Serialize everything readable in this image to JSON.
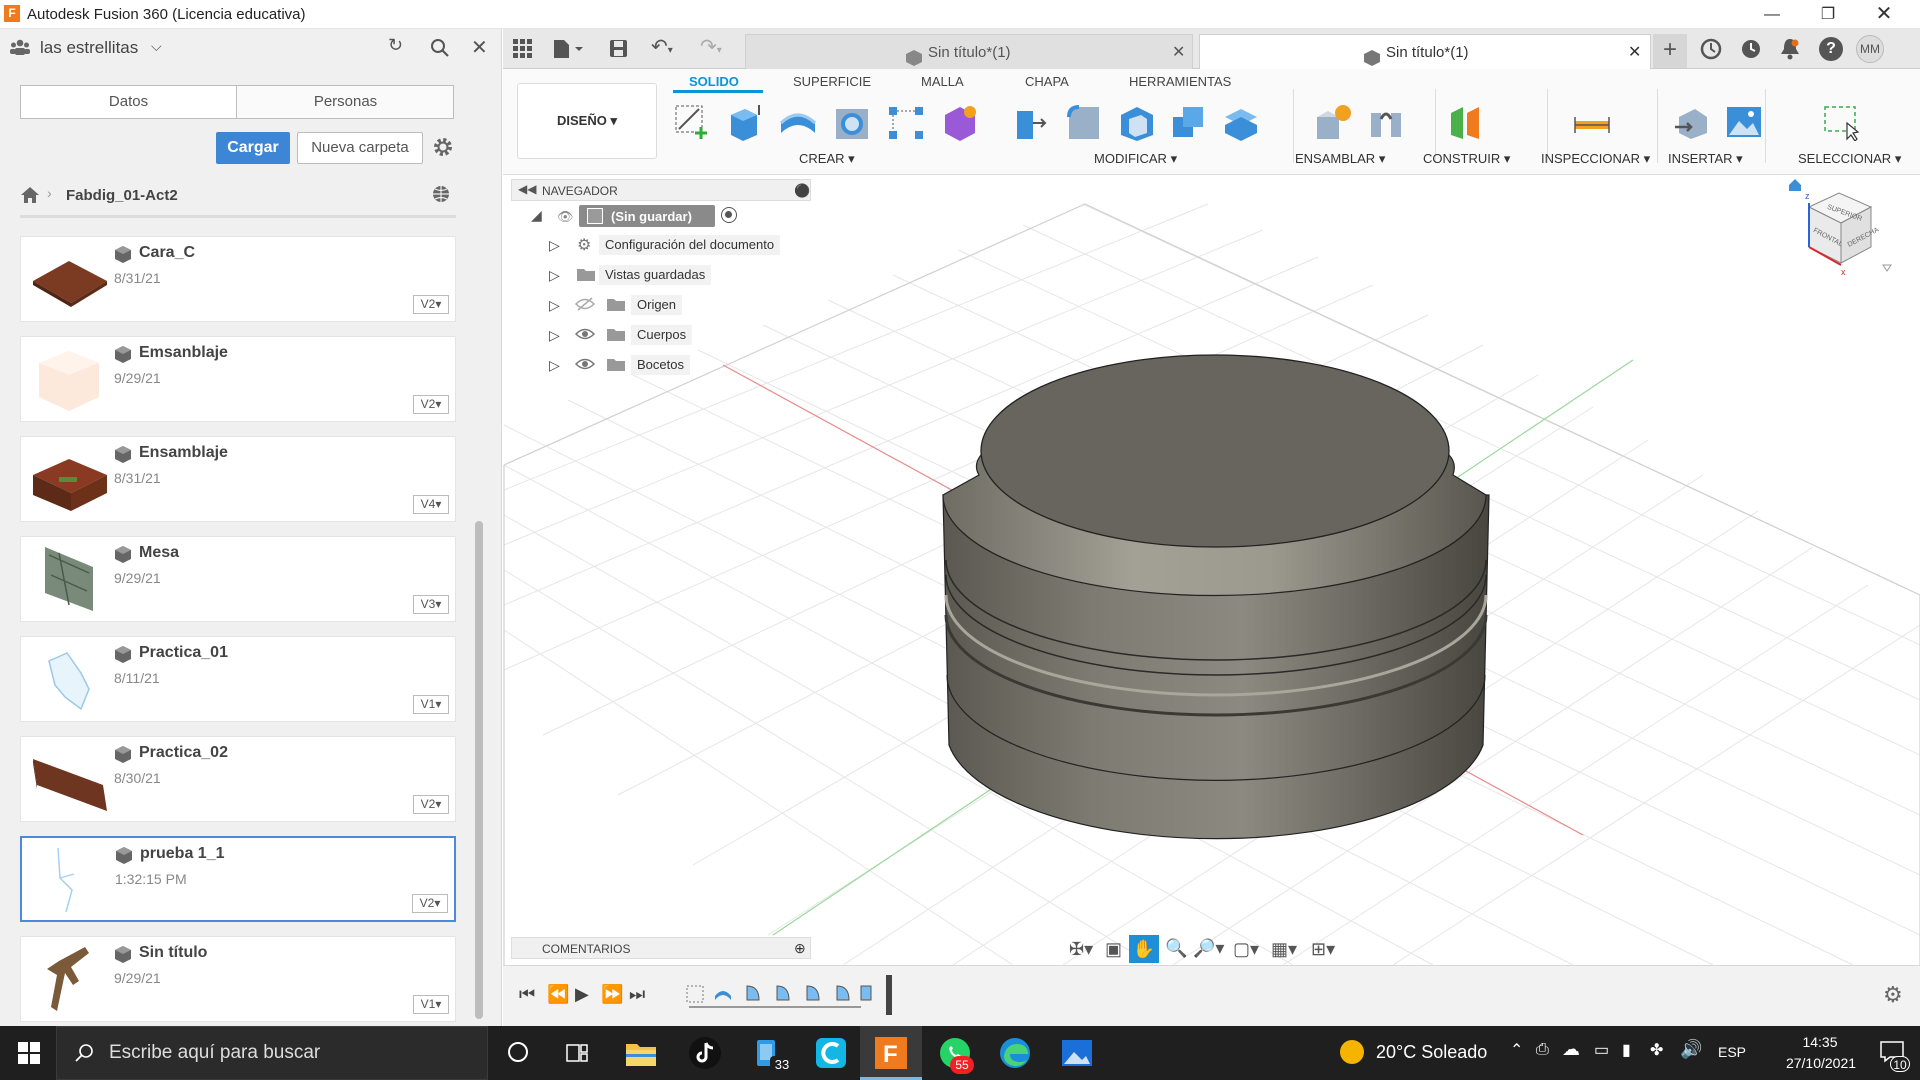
{
  "window": {
    "title": "Autodesk Fusion 360 (Licencia educativa)",
    "app_icon": "F"
  },
  "left_panel": {
    "team_name": "las estrellitas",
    "tabs": [
      "Datos",
      "Personas"
    ],
    "buttons": {
      "upload": "Cargar",
      "new_folder": "Nueva carpeta"
    },
    "breadcrumb": "Fabdig_01-Act2",
    "files": [
      {
        "name": "Cara_C",
        "date": "8/31/21",
        "version": "V2"
      },
      {
        "name": "Emsanblaje",
        "date": "9/29/21",
        "version": "V2"
      },
      {
        "name": "Ensamblaje",
        "date": "8/31/21",
        "version": "V4"
      },
      {
        "name": "Mesa",
        "date": "9/29/21",
        "version": "V3"
      },
      {
        "name": "Practica_01",
        "date": "8/11/21",
        "version": "V1"
      },
      {
        "name": "Practica_02",
        "date": "8/30/21",
        "version": "V2"
      },
      {
        "name": "prueba 1_1",
        "date": "1:32:15 PM",
        "version": "V2"
      },
      {
        "name": "Sin título",
        "date": "9/29/21",
        "version": "V1"
      }
    ]
  },
  "doc_tabs": [
    "Sin título*(1)",
    "Sin título*(1)"
  ],
  "user_initials": "MM",
  "ribbon": {
    "workspace": "DISEÑO",
    "tabs": [
      "SOLIDO",
      "SUPERFICIE",
      "MALLA",
      "CHAPA",
      "HERRAMIENTAS"
    ],
    "groups": [
      "CREAR",
      "MODIFICAR",
      "ENSAMBLAR",
      "CONSTRUIR",
      "INSPECCIONAR",
      "INSERTAR",
      "SELECCIONAR"
    ],
    "accent": "#0696d7"
  },
  "navigator": {
    "title": "NAVEGADOR",
    "root": "(Sin guardar)",
    "items": [
      "Configuración del documento",
      "Vistas guardadas",
      "Origen",
      "Cuerpos",
      "Bocetos"
    ]
  },
  "comments_label": "COMENTARIOS",
  "viewcube": {
    "faces": [
      "SUPERIOR",
      "FRONTAL",
      "DERECHA"
    ]
  },
  "taskbar": {
    "search_placeholder": "Escribe aquí para buscar",
    "weather": "20°C Soleado",
    "language": "ESP",
    "time": "14:35",
    "date": "27/10/2021",
    "badges": {
      "store": "33",
      "whatsapp": "55",
      "notifications": "10"
    }
  }
}
